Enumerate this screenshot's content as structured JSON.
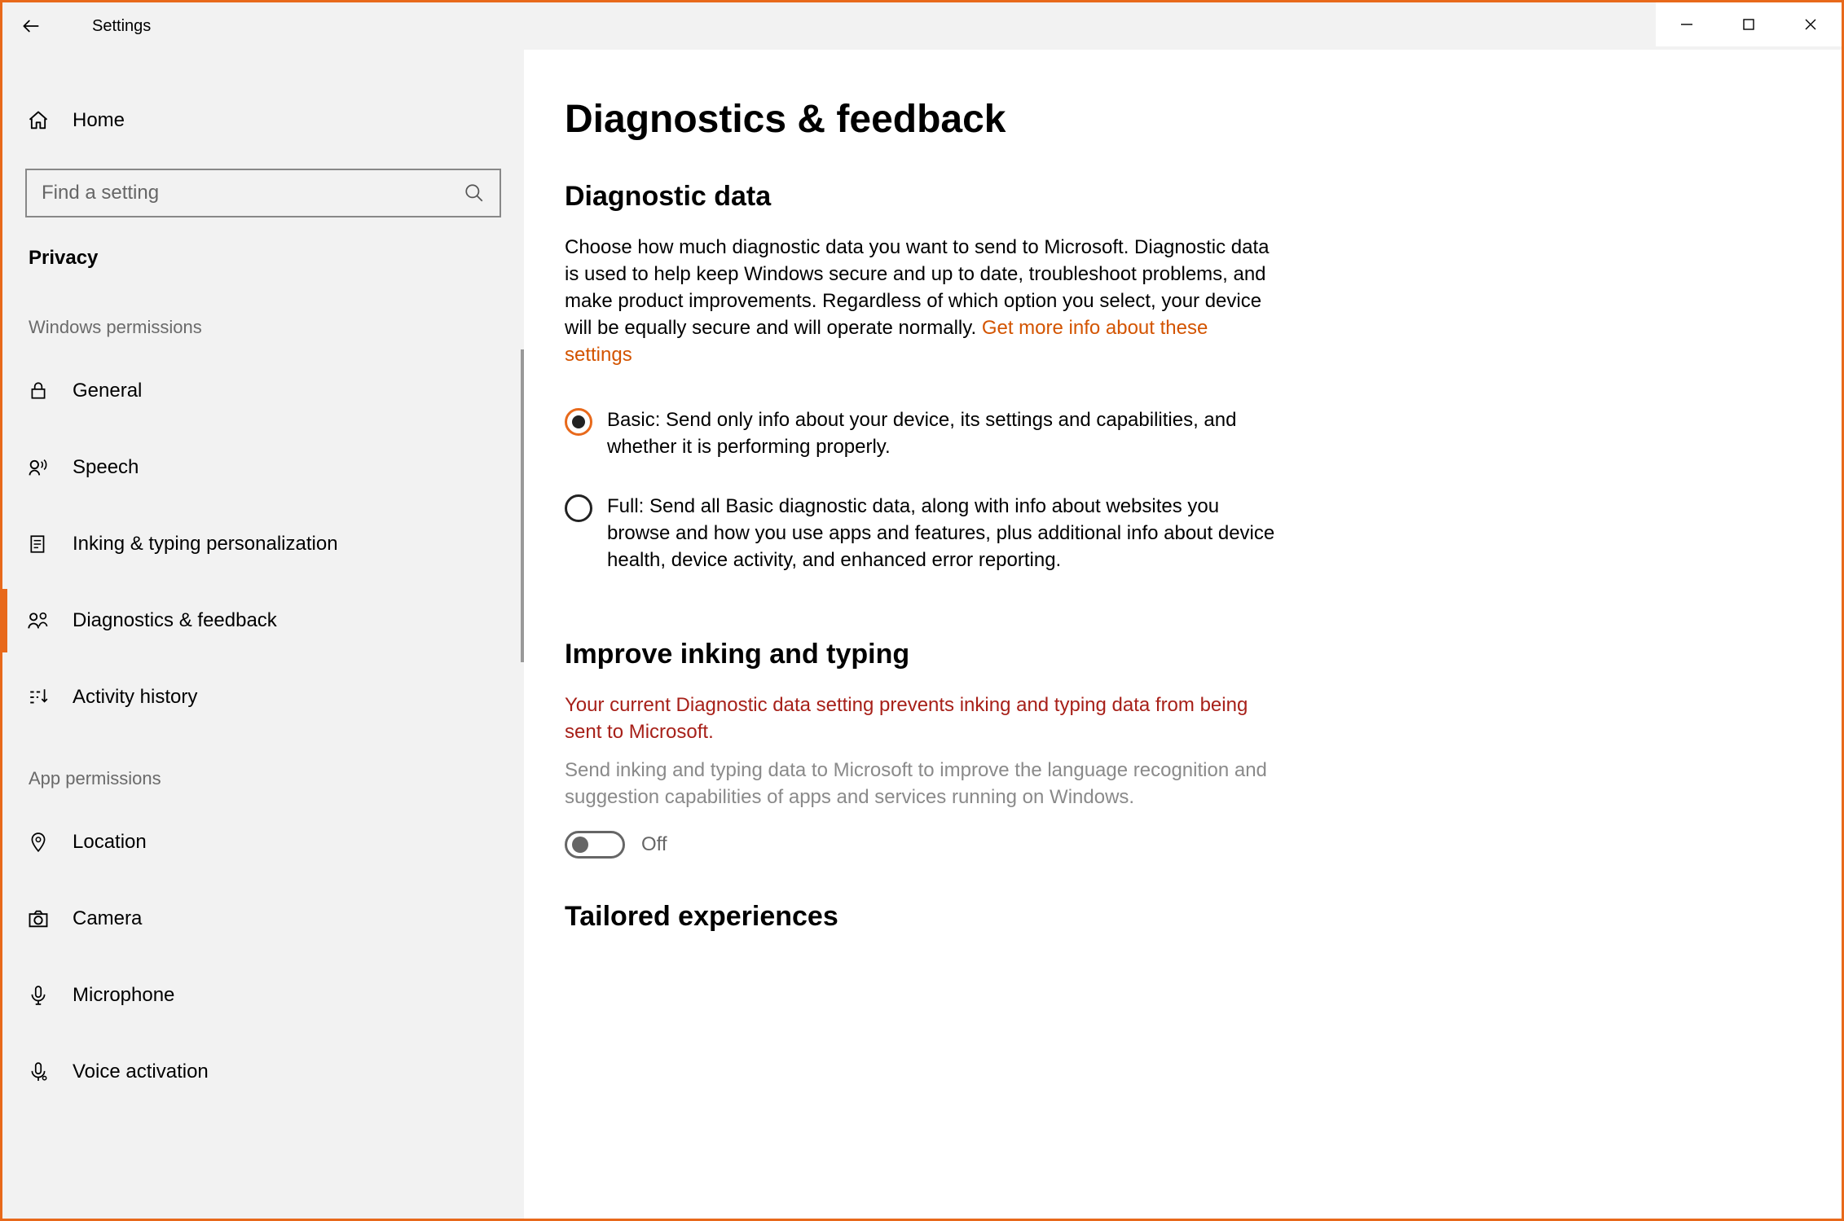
{
  "app_title": "Settings",
  "window_controls": {
    "minimize": "minimize",
    "maximize": "maximize",
    "close": "close"
  },
  "sidebar": {
    "home": "Home",
    "search_placeholder": "Find a setting",
    "category": "Privacy",
    "groups": [
      {
        "label": "Windows permissions",
        "items": [
          {
            "icon": "lock-icon",
            "label": "General"
          },
          {
            "icon": "speech-icon",
            "label": "Speech"
          },
          {
            "icon": "inking-icon",
            "label": "Inking & typing personalization"
          },
          {
            "icon": "feedback-icon",
            "label": "Diagnostics & feedback",
            "selected": true
          },
          {
            "icon": "activity-icon",
            "label": "Activity history"
          }
        ]
      },
      {
        "label": "App permissions",
        "items": [
          {
            "icon": "location-icon",
            "label": "Location"
          },
          {
            "icon": "camera-icon",
            "label": "Camera"
          },
          {
            "icon": "microphone-icon",
            "label": "Microphone"
          },
          {
            "icon": "voice-icon",
            "label": "Voice activation"
          }
        ]
      }
    ]
  },
  "main": {
    "title": "Diagnostics & feedback",
    "section1_heading": "Diagnostic data",
    "section1_text": "Choose how much diagnostic data you want to send to Microsoft. Diagnostic data is used to help keep Windows secure and up to date, troubleshoot problems, and make product improvements. Regardless of which option you select, your device will be equally secure and will operate normally. ",
    "section1_link": "Get more info about these settings",
    "radios": [
      {
        "selected": true,
        "text": "Basic: Send only info about your device, its settings and capabilities, and whether it is performing properly."
      },
      {
        "selected": false,
        "text": "Full: Send all Basic diagnostic data, along with info about websites you browse and how you use apps and features, plus additional info about device health, device activity, and enhanced error reporting."
      }
    ],
    "section2_heading": "Improve inking and typing",
    "section2_warn": "Your current Diagnostic data setting prevents inking and typing data from being sent to Microsoft.",
    "section2_gray": "Send inking and typing data to Microsoft to improve the language recognition and suggestion capabilities of apps and services running on Windows.",
    "toggle_state": "Off",
    "section3_heading": "Tailored experiences"
  }
}
